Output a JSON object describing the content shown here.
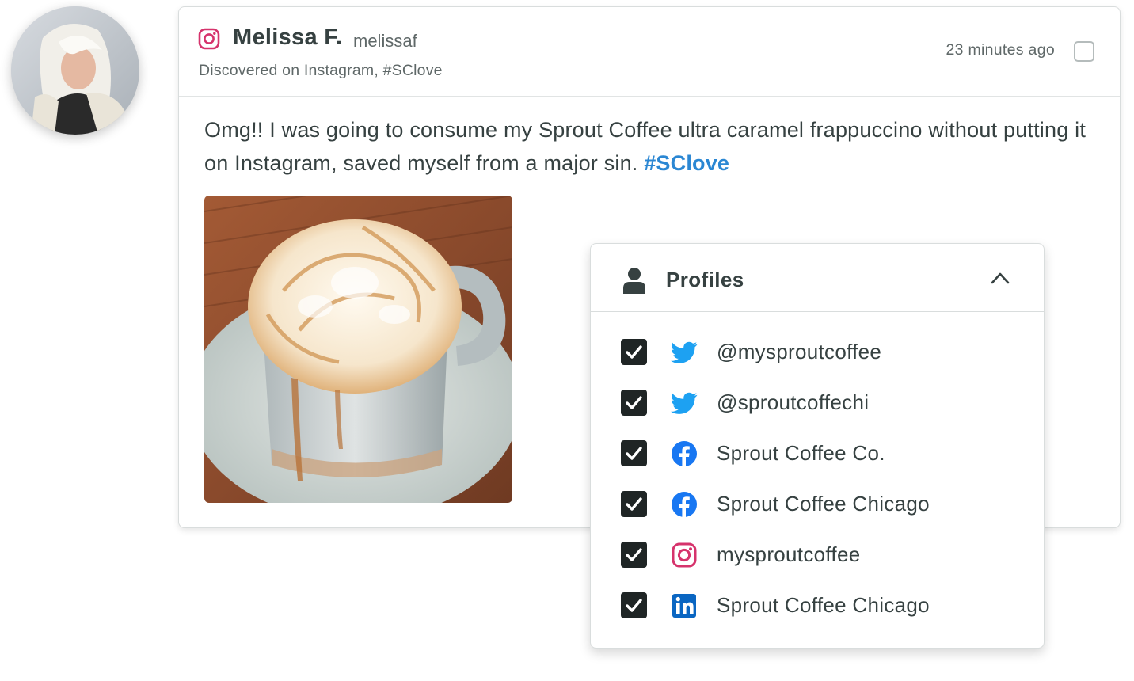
{
  "post": {
    "author_name": "Melissa F.",
    "author_handle": "melissaf",
    "source": "Discovered on Instagram,  #SClove",
    "timestamp": "23 minutes ago",
    "text_before": "Omg!! I was going to consume my Sprout Coffee ultra caramel frappuccino without putting it on Instagram, saved myself from a major sin. ",
    "hashtag": "#SClove",
    "network_icon": "instagram-icon",
    "image": "caramel-latte-mug-photo"
  },
  "profiles_panel": {
    "title": "Profiles",
    "icons": {
      "header": "person-icon",
      "toggle": "chevron-up-icon"
    },
    "items": [
      {
        "label": "@mysproutcoffee",
        "network": "twitter",
        "icon": "twitter-icon",
        "checked": true
      },
      {
        "label": "@sproutcoffechi",
        "network": "twitter",
        "icon": "twitter-icon",
        "checked": true
      },
      {
        "label": "Sprout Coffee Co.",
        "network": "facebook",
        "icon": "facebook-icon",
        "checked": true
      },
      {
        "label": "Sprout Coffee Chicago",
        "network": "facebook",
        "icon": "facebook-icon",
        "checked": true
      },
      {
        "label": "mysproutcoffee",
        "network": "instagram",
        "icon": "instagram-icon",
        "checked": true
      },
      {
        "label": "Sprout Coffee Chicago",
        "network": "linkedin",
        "icon": "linkedin-icon",
        "checked": true
      }
    ]
  },
  "colors": {
    "text": "#364141",
    "muted": "#5f6868",
    "hashtag": "#2b87d3",
    "twitter": "#1da1f2",
    "facebook": "#1877f2",
    "instagram": "#d6336c",
    "linkedin": "#0a66c2",
    "checkbox": "#1f2525"
  }
}
